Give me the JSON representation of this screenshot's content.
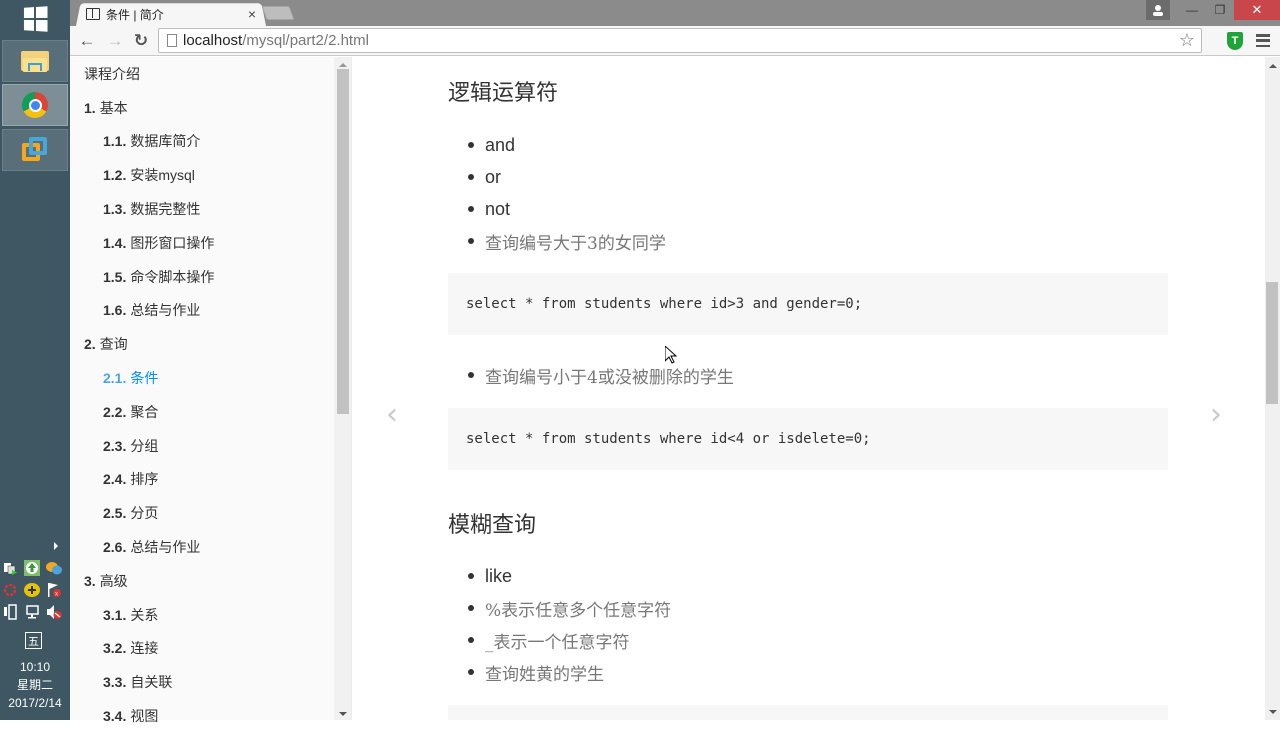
{
  "taskbar": {
    "apps": [
      {
        "name": "File Explorer",
        "icon": "folder-icon",
        "active": false
      },
      {
        "name": "Google Chrome",
        "icon": "chrome-icon",
        "active": true
      },
      {
        "name": "VMware",
        "icon": "vmware-icon",
        "active": false
      }
    ],
    "tray_icons": [
      "network-share-icon",
      "update-icon",
      "chat-icon",
      "flower-icon",
      "plus-icon",
      "flag-icon",
      "power-icon",
      "network-icon",
      "volume-muted-icon"
    ],
    "ime_label": "五",
    "clock": {
      "time": "10:10",
      "weekday": "星期二",
      "date": "2017/2/14"
    }
  },
  "browser": {
    "tab": {
      "title": "条件 | 简介",
      "close": "×"
    },
    "window_controls": {
      "minimize": "—",
      "restore": "❐",
      "close": "✕"
    },
    "url": {
      "host": "localhost",
      "path": "/mysql/part2/2.html"
    },
    "nav": {
      "back": "←",
      "forward": "→",
      "reload": "↻"
    },
    "extension_label": "T"
  },
  "sidebar": {
    "items": [
      {
        "num": "",
        "label": "课程介绍",
        "level": 1,
        "active": false
      },
      {
        "num": "1.",
        "label": "基本",
        "level": 1,
        "active": false
      },
      {
        "num": "1.1.",
        "label": "数据库简介",
        "level": 2,
        "active": false
      },
      {
        "num": "1.2.",
        "label": "安装mysql",
        "level": 2,
        "active": false
      },
      {
        "num": "1.3.",
        "label": "数据完整性",
        "level": 2,
        "active": false
      },
      {
        "num": "1.4.",
        "label": "图形窗口操作",
        "level": 2,
        "active": false
      },
      {
        "num": "1.5.",
        "label": "命令脚本操作",
        "level": 2,
        "active": false
      },
      {
        "num": "1.6.",
        "label": "总结与作业",
        "level": 2,
        "active": false
      },
      {
        "num": "2.",
        "label": "查询",
        "level": 1,
        "active": false
      },
      {
        "num": "2.1.",
        "label": "条件",
        "level": 2,
        "active": true
      },
      {
        "num": "2.2.",
        "label": "聚合",
        "level": 2,
        "active": false
      },
      {
        "num": "2.3.",
        "label": "分组",
        "level": 2,
        "active": false
      },
      {
        "num": "2.4.",
        "label": "排序",
        "level": 2,
        "active": false
      },
      {
        "num": "2.5.",
        "label": "分页",
        "level": 2,
        "active": false
      },
      {
        "num": "2.6.",
        "label": "总结与作业",
        "level": 2,
        "active": false
      },
      {
        "num": "3.",
        "label": "高级",
        "level": 1,
        "active": false
      },
      {
        "num": "3.1.",
        "label": "关系",
        "level": 2,
        "active": false
      },
      {
        "num": "3.2.",
        "label": "连接",
        "level": 2,
        "active": false
      },
      {
        "num": "3.3.",
        "label": "自关联",
        "level": 2,
        "active": false
      },
      {
        "num": "3.4.",
        "label": "视图",
        "level": 2,
        "active": false
      }
    ],
    "active_color": "#008cff"
  },
  "content": {
    "prev_arrow": "‹",
    "next_arrow": "›",
    "section1": {
      "heading": "逻辑运算符",
      "bullets": [
        "and",
        "or",
        "not",
        "查询编号大于3的女同学"
      ],
      "code1": "select * from students where id>3 and gender=0;",
      "bullet2": "查询编号小于4或没被删除的学生",
      "code2": "select * from students where id<4 or isdelete=0;"
    },
    "section2": {
      "heading": "模糊查询",
      "bullets": [
        "like",
        "%表示任意多个任意字符",
        "_表示一个任意字符",
        "查询姓黄的学生"
      ]
    }
  }
}
